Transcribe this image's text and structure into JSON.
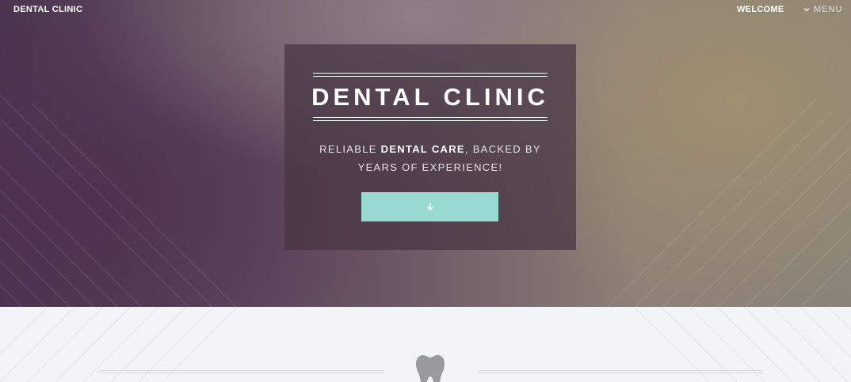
{
  "header": {
    "brand": "DENTAL CLINIC",
    "nav_welcome": "WELCOME",
    "nav_menu": "MENU",
    "menu_icon": "chevron-down-icon"
  },
  "hero": {
    "title": "DENTAL CLINIC",
    "tagline_part1": "RELIABLE ",
    "tagline_bold": "DENTAL CARE",
    "tagline_part2": ", BACKED BY YEARS OF EXPERIENCE!",
    "button_icon": "arrow-down-icon"
  },
  "section": {
    "icon": "tooth-icon"
  },
  "colors": {
    "accent": "#98d9d1",
    "hero_box": "#463444",
    "lower_bg": "#f2f4f8",
    "tooth": "#9a9a9c"
  }
}
